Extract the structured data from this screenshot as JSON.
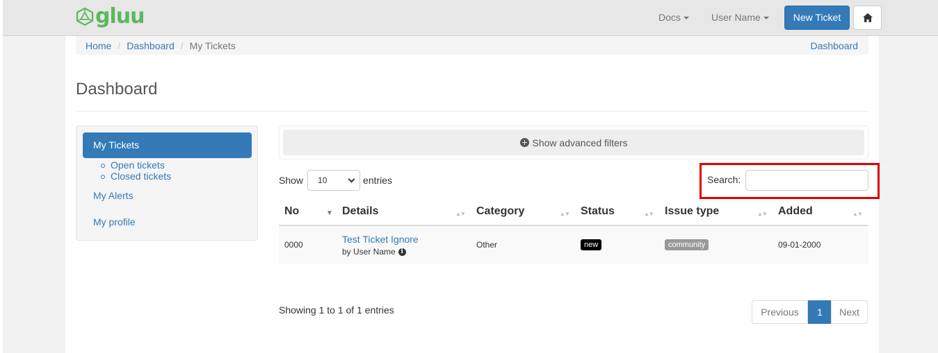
{
  "navbar": {
    "logo_text": "gluu",
    "docs_label": "Docs",
    "user_label": "User Name",
    "new_ticket_label": "New Ticket"
  },
  "breadcrumb": {
    "home": "Home",
    "dashboard": "Dashboard",
    "current": "My Tickets",
    "right_link": "Dashboard"
  },
  "page": {
    "title": "Dashboard"
  },
  "sidebar": {
    "active": "My Tickets",
    "sub_items": [
      "Open tickets",
      "Closed tickets"
    ],
    "alerts": "My Alerts",
    "profile": "My profile"
  },
  "filters": {
    "label": "Show advanced filters"
  },
  "table_controls": {
    "show_label": "Show",
    "page_size": "10",
    "entries_label": "entries",
    "search_label": "Search:"
  },
  "table": {
    "headers": [
      "No",
      "Details",
      "Category",
      "Status",
      "Issue type",
      "Added"
    ],
    "rows": [
      {
        "no": "0000",
        "title": "Test Ticket Ignore",
        "by": "by User Name",
        "category": "Other",
        "status": "new",
        "issue_type": "community",
        "added": "09-01-2000"
      }
    ]
  },
  "footer": {
    "info": "Showing 1 to 1 of 1 entries",
    "prev": "Previous",
    "page": "1",
    "next": "Next"
  },
  "colors": {
    "primary": "#337ab7",
    "brand": "#5cb85c",
    "highlight": "#e00000"
  }
}
